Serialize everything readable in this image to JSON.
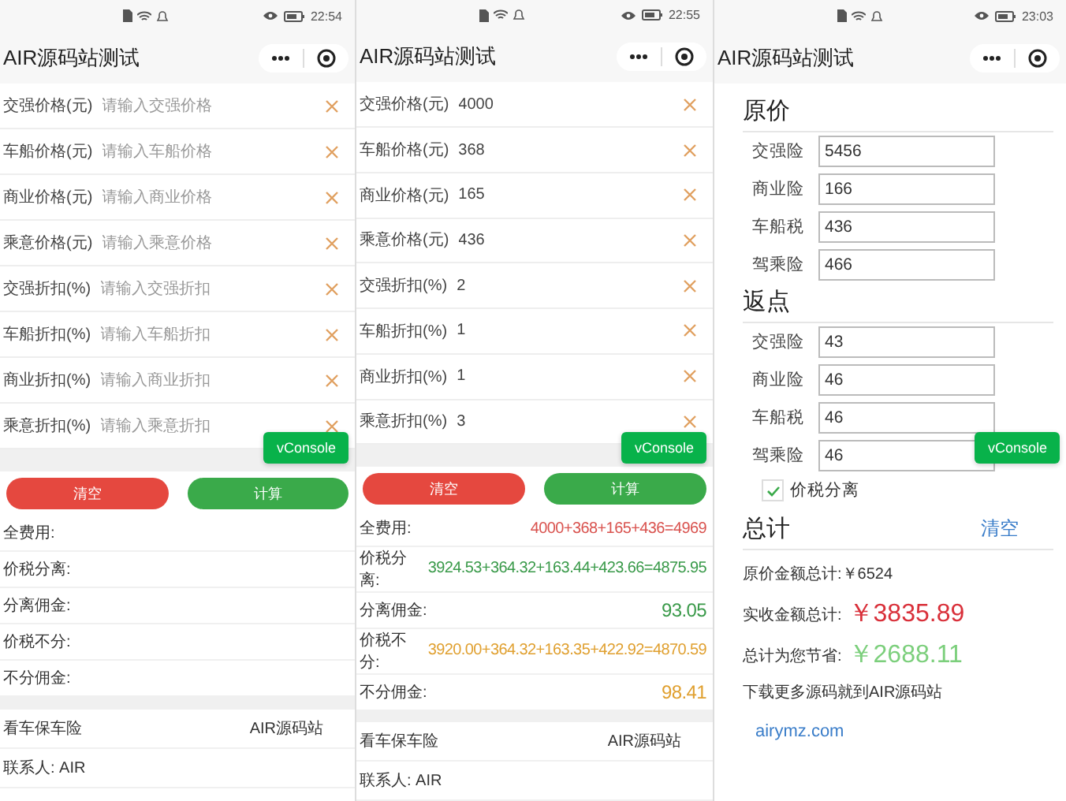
{
  "screens": [
    {
      "kind": "form",
      "status_bar": {
        "time": "22:54"
      },
      "title": "AIR源码站测试",
      "fields": [
        {
          "label": "交强价格(元)",
          "placeholder": "请输入交强价格"
        },
        {
          "label": "车船价格(元)",
          "placeholder": "请输入车船价格"
        },
        {
          "label": "商业价格(元)",
          "placeholder": "请输入商业价格"
        },
        {
          "label": "乘意价格(元)",
          "placeholder": "请输入乘意价格"
        },
        {
          "label": "交强折扣(%)",
          "placeholder": "请输入交强折扣"
        },
        {
          "label": "车船折扣(%)",
          "placeholder": "请输入车船折扣"
        },
        {
          "label": "商业折扣(%)",
          "placeholder": "请输入商业折扣"
        },
        {
          "label": "乘意折扣(%)",
          "placeholder": "请输入乘意折扣"
        }
      ],
      "buttons": [
        {
          "label": "清空",
          "kind": "danger"
        },
        {
          "label": "计算",
          "kind": "primary"
        }
      ],
      "results": [
        {
          "label": "全费用:"
        },
        {
          "label": "价税分离:"
        },
        {
          "label": "分离佣金:"
        },
        {
          "label": "价税不分:"
        },
        {
          "label": "不分佣金:"
        }
      ],
      "footer": [
        {
          "label": "看车保车险",
          "value": "AIR源码站"
        },
        {
          "label": "联系人: AIR"
        }
      ],
      "vconsole": "vConsole"
    },
    {
      "kind": "form",
      "status_bar": {
        "time": "22:55"
      },
      "title": "AIR源码站测试",
      "fields": [
        {
          "label": "交强价格(元)",
          "value": "4000"
        },
        {
          "label": "车船价格(元)",
          "value": "368"
        },
        {
          "label": "商业价格(元)",
          "value": "165"
        },
        {
          "label": "乘意价格(元)",
          "value": "436"
        },
        {
          "label": "交强折扣(%)",
          "value": "2"
        },
        {
          "label": "车船折扣(%)",
          "value": "1"
        },
        {
          "label": "商业折扣(%)",
          "value": "1"
        },
        {
          "label": "乘意折扣(%)",
          "value": "3"
        }
      ],
      "buttons": [
        {
          "label": "清空",
          "kind": "danger"
        },
        {
          "label": "计算",
          "kind": "primary"
        }
      ],
      "results": [
        {
          "label": "全费用:",
          "value": "4000+368+165+436=4969",
          "color": "#d9534f"
        },
        {
          "label": "价税分离:",
          "value": "3924.53+364.32+163.44+423.66=4875.95",
          "color": "#3a9a4a"
        },
        {
          "label": "分离佣金:",
          "value": "93.05",
          "color": "#3a9a4a"
        },
        {
          "label": "价税不分:",
          "value": "3920.00+364.32+163.35+422.92=4870.59",
          "color": "#e0a030"
        },
        {
          "label": "不分佣金:",
          "value": "98.41",
          "color": "#e0a030"
        }
      ],
      "footer": [
        {
          "label": "看车保车险",
          "value": "AIR源码站"
        },
        {
          "label": "联系人: AIR"
        }
      ],
      "vconsole": "vConsole"
    },
    {
      "kind": "calculator",
      "status_bar": {
        "time": "23:03"
      },
      "title": "AIR源码站测试",
      "sections": [
        {
          "heading": "原价",
          "rows": [
            {
              "label": "交强险",
              "value": "5456"
            },
            {
              "label": "商业险",
              "value": "166"
            },
            {
              "label": "车船税",
              "value": "436"
            },
            {
              "label": "驾乘险",
              "value": "466"
            }
          ]
        },
        {
          "heading": "返点",
          "rows": [
            {
              "label": "交强险",
              "value": "43"
            },
            {
              "label": "商业险",
              "value": "46"
            },
            {
              "label": "车船税",
              "value": "46"
            },
            {
              "label": "驾乘险",
              "value": "46"
            }
          ]
        }
      ],
      "tax_split": {
        "label": "价税分离",
        "checked": true
      },
      "total": {
        "heading": "总计",
        "clear": "清空"
      },
      "summary": [
        {
          "label": "原价金额总计:￥6524"
        },
        {
          "label": "实收金额总计:",
          "value": "￥3835.89",
          "color": "#d9303a"
        },
        {
          "label": "总计为您节省:",
          "value": "￥2688.11",
          "color": "#7ccf7c"
        }
      ],
      "note": "下载更多源码就到AIR源码站",
      "link": "airymz.com",
      "vconsole": "vConsole"
    }
  ]
}
